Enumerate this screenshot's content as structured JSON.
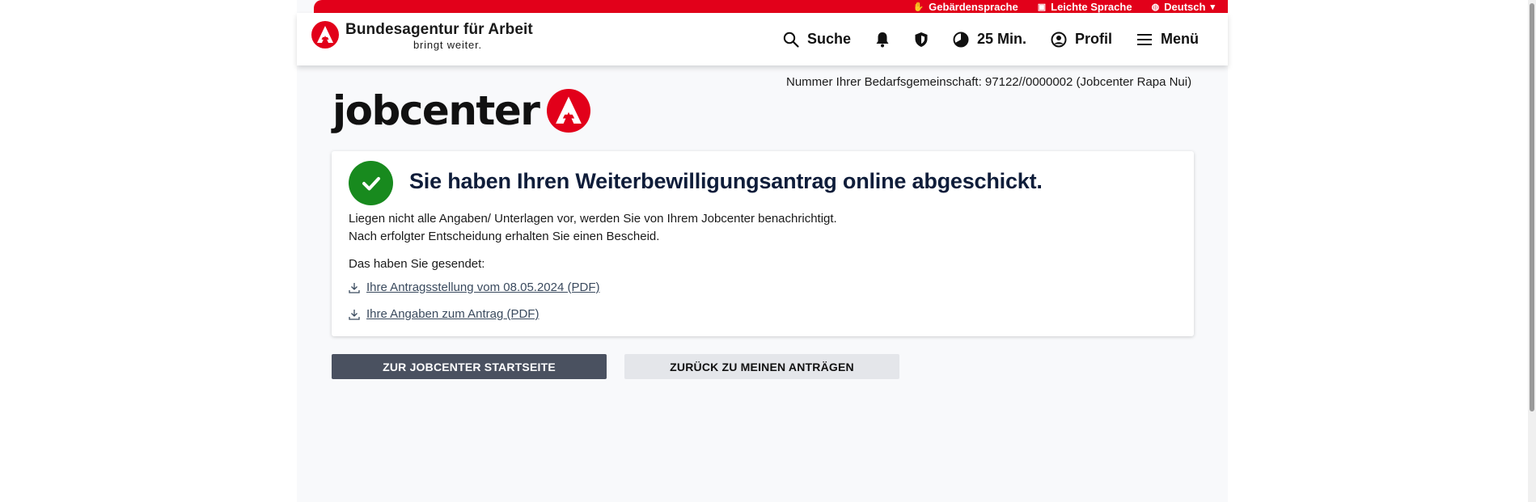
{
  "topbar": {
    "items": [
      {
        "label": "Gebärdensprache",
        "icon": "hand-icon"
      },
      {
        "label": "Leichte Sprache",
        "icon": "easy-language-icon"
      },
      {
        "label": "Deutsch",
        "icon": "globe-icon"
      }
    ]
  },
  "header": {
    "org_name": "Bundesagentur für Arbeit",
    "tagline": "bringt weiter.",
    "nav": {
      "search_label": "Suche",
      "timer_label": "25 Min.",
      "profile_label": "Profil",
      "menu_label": "Menü"
    }
  },
  "main": {
    "bg_number": "Nummer Ihrer Bedarfsgemeinschaft: 97122//0000002 (Jobcenter Rapa Nui)",
    "jobcenter_logo_text": "jobcenter",
    "card": {
      "title": "Sie haben Ihren Weiterbewilligungsantrag online abgeschickt.",
      "line1": "Liegen nicht alle Angaben/ Unterlagen vor, werden Sie von Ihrem Jobcenter benachrichtigt.",
      "line2": "Nach erfolgter Entscheidung erhalten Sie einen Bescheid.",
      "sent_label": "Das haben Sie gesendet:",
      "links": [
        "Ihre Antragsstellung vom 08.05.2024 (PDF)",
        "Ihre Angaben zum Antrag (PDF)"
      ]
    },
    "buttons": {
      "primary": "ZUR JOBCENTER STARTSEITE",
      "secondary": "ZURÜCK ZU MEINEN ANTRÄGEN"
    }
  },
  "colors": {
    "brand_red": "#e2001a",
    "success_green": "#188a1e",
    "primary_button": "#4a5160",
    "secondary_button": "#e4e6ea",
    "title_navy": "#0f1d3a"
  }
}
